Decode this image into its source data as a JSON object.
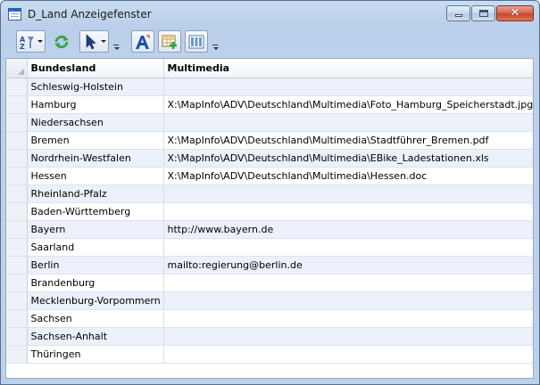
{
  "window": {
    "title": "D_Land Anzeigefenster",
    "close_glyph": "✕"
  },
  "toolbar": {
    "icons": [
      "sort-az-icon",
      "refresh-icon",
      "select-arrow-icon",
      "font-style-icon",
      "add-column-icon",
      "column-layout-icon"
    ]
  },
  "table": {
    "columns": [
      "Bundesland",
      "Multimedia"
    ],
    "rows": [
      {
        "bundesland": "Schleswig-Holstein",
        "multimedia": ""
      },
      {
        "bundesland": "Hamburg",
        "multimedia": "X:\\MapInfo\\ADV\\Deutschland\\Multimedia\\Foto_Hamburg_Speicherstadt.jpg"
      },
      {
        "bundesland": "Niedersachsen",
        "multimedia": ""
      },
      {
        "bundesland": "Bremen",
        "multimedia": "X:\\MapInfo\\ADV\\Deutschland\\Multimedia\\Stadtführer_Bremen.pdf"
      },
      {
        "bundesland": "Nordrhein-Westfalen",
        "multimedia": "X:\\MapInfo\\ADV\\Deutschland\\Multimedia\\EBike_Ladestationen.xls"
      },
      {
        "bundesland": "Hessen",
        "multimedia": "X:\\MapInfo\\ADV\\Deutschland\\Multimedia\\Hessen.doc"
      },
      {
        "bundesland": "Rheinland-Pfalz",
        "multimedia": ""
      },
      {
        "bundesland": "Baden-Württemberg",
        "multimedia": ""
      },
      {
        "bundesland": "Bayern",
        "multimedia": "http://www.bayern.de"
      },
      {
        "bundesland": "Saarland",
        "multimedia": ""
      },
      {
        "bundesland": "Berlin",
        "multimedia": "mailto:regierung@berlin.de"
      },
      {
        "bundesland": "Brandenburg",
        "multimedia": ""
      },
      {
        "bundesland": "Mecklenburg-Vorpommern",
        "multimedia": ""
      },
      {
        "bundesland": "Sachsen",
        "multimedia": ""
      },
      {
        "bundesland": "Sachsen-Anhalt",
        "multimedia": ""
      },
      {
        "bundesland": "Thüringen",
        "multimedia": ""
      }
    ]
  },
  "colors": {
    "alt_row": "#ecf0fb",
    "frame": "#bcd2ec",
    "close_button": "#c5452a"
  }
}
